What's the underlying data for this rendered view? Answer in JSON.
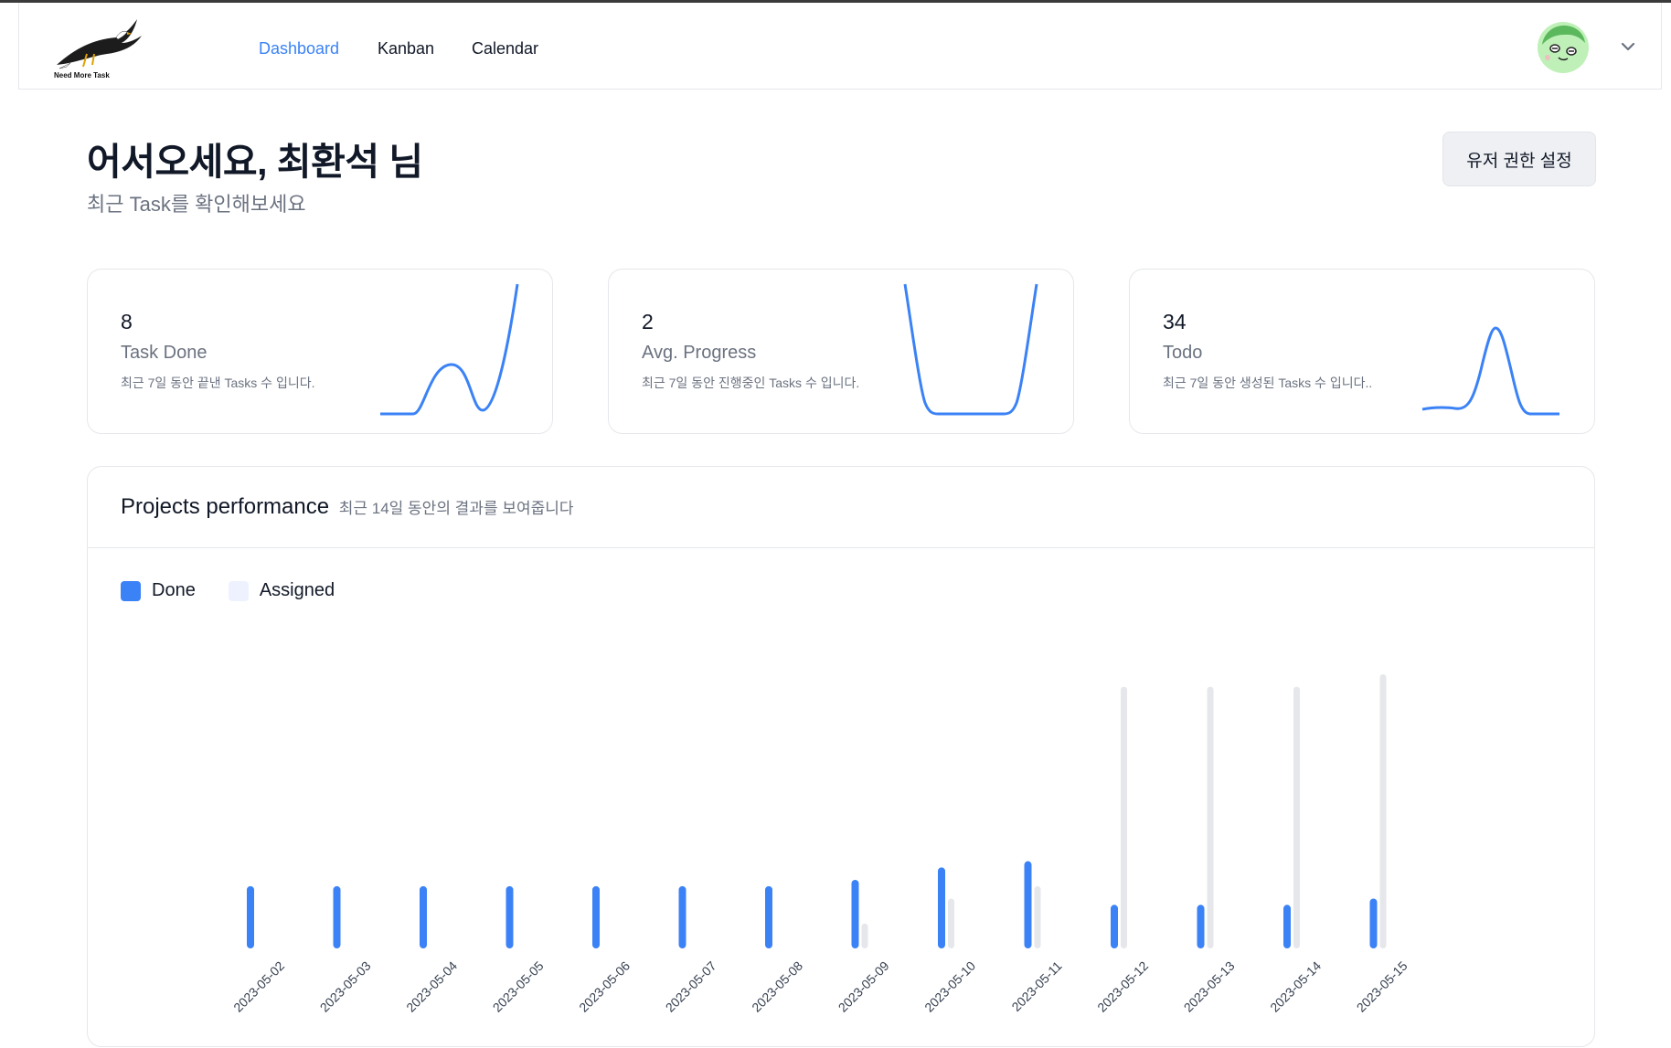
{
  "header": {
    "logo_text": "Need More Task",
    "nav": [
      "Dashboard",
      "Kanban",
      "Calendar"
    ],
    "active_nav": "Dashboard",
    "accent_color": "#3b82f6"
  },
  "greeting": {
    "title": "어서오세요, 최환석 님",
    "subtitle": "최근 Task를 확인해보세요"
  },
  "permission_button": "유저 권한 설정",
  "stats": [
    {
      "value": "8",
      "label": "Task Done",
      "desc": "최근 7일 동안 끝낸 Tasks 수 입니다."
    },
    {
      "value": "2",
      "label": "Avg. Progress",
      "desc": "최근 7일 동안 진행중인 Tasks 수 입니다."
    },
    {
      "value": "34",
      "label": "Todo",
      "desc": "최근 7일 동안 생성된 Tasks 수 입니다.."
    }
  ],
  "performance": {
    "title": "Projects performance",
    "subtitle": "최근 14일 동안의 결과를 보여줍니다",
    "legend": [
      {
        "name": "Done",
        "color": "#3b82f6"
      },
      {
        "name": "Assigned",
        "color": "#eef2ff"
      }
    ]
  },
  "chart_data": {
    "type": "bar",
    "categories": [
      "2023-05-02",
      "2023-05-03",
      "2023-05-04",
      "2023-05-05",
      "2023-05-06",
      "2023-05-07",
      "2023-05-08",
      "2023-05-09",
      "2023-05-10",
      "2023-05-11",
      "2023-05-12",
      "2023-05-13",
      "2023-05-14",
      "2023-05-15"
    ],
    "series": [
      {
        "name": "Done",
        "color": "#3b82f6",
        "values": [
          5,
          5,
          5,
          5,
          5,
          5,
          5,
          5.5,
          6.5,
          7,
          3.5,
          3.5,
          3.5,
          4
        ]
      },
      {
        "name": "Assigned",
        "color": "#e5e7eb",
        "values": [
          0,
          0,
          0,
          0,
          0,
          0,
          0,
          2,
          4,
          5,
          21,
          21,
          21,
          22
        ]
      }
    ],
    "ylim": [
      0,
      22
    ],
    "grid": false,
    "legend_position": "top-left",
    "tick_rotation": -45
  },
  "sparklines": [
    {
      "type": "line",
      "values": [
        0,
        0,
        0.2,
        4,
        0.5,
        9.5
      ]
    },
    {
      "type": "line",
      "values": [
        10,
        0,
        0,
        0,
        0,
        10
      ]
    },
    {
      "type": "line",
      "values": [
        0.5,
        0.5,
        1,
        7,
        0.2,
        0
      ]
    }
  ]
}
